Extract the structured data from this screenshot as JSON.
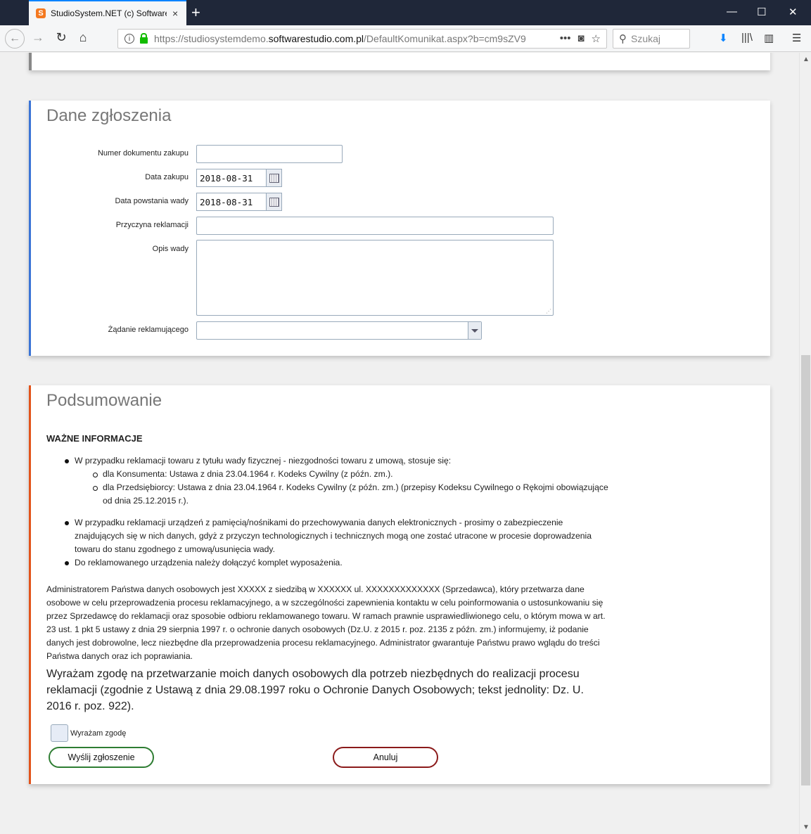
{
  "browser": {
    "tab_title": "StudioSystem.NET (c) Software",
    "tab_close": "×",
    "new_tab": "+",
    "window_controls": {
      "minimize": "—",
      "maximize": "☐",
      "close": "✕"
    },
    "url_prefix": "https://studiosystemdemo.",
    "url_domain": "softwarestudio.com.pl",
    "url_suffix": "/DefaultKomunikat.aspx?b=cm9sZV9",
    "url_more": "•••",
    "search_placeholder": "Szukaj"
  },
  "dane": {
    "title": "Dane zgłoszenia",
    "labels": {
      "numer": "Numer dokumentu zakupu",
      "data_zakupu": "Data zakupu",
      "data_wady": "Data powstania wady",
      "przyczyna": "Przyczyna reklamacji",
      "opis": "Opis wady",
      "zadanie": "Żądanie reklamującego"
    },
    "values": {
      "numer": "",
      "data_zakupu": "2018-08-31",
      "data_wady": "2018-08-31",
      "przyczyna": "",
      "opis": "",
      "zadanie": ""
    }
  },
  "podsumowanie": {
    "title": "Podsumowanie",
    "heading": "WAŻNE INFORMACJE",
    "bullet1": "W przypadku reklamacji towaru z tytułu wady fizycznej - niezgodności towaru z umową, stosuje się:",
    "sub1": "dla Konsumenta: Ustawa z dnia 23.04.1964 r. Kodeks Cywilny (z późn. zm.).",
    "sub2": "dla Przedsiębiorcy: Ustawa z dnia 23.04.1964 r. Kodeks Cywilny (z późn. zm.) (przepisy Kodeksu Cywilnego o Rękojmi obowiązujące od dnia 25.12.2015 r.).",
    "bullet2": "W przypadku reklamacji urządzeń z pamięcią/nośnikami do przechowywania danych elektronicznych - prosimy o zabezpieczenie znajdujących się w nich danych, gdyż z przyczyn technologicznych i technicznych mogą one zostać utracone w procesie doprowadzenia towaru do stanu zgodnego z umową/usunięcia wady.",
    "bullet3": "Do reklamowanego urządzenia należy dołączyć komplet wyposażenia.",
    "admin_text": "Administratorem Państwa danych osobowych jest XXXXX z siedzibą w XXXXXX ul. XXXXXXXXXXXXX (Sprzedawca), który przetwarza dane osobowe w celu przeprowadzenia procesu reklamacyjnego, a w szczególności zapewnienia kontaktu w celu poinformowania o ustosunkowaniu się przez Sprzedawcę do reklamacji oraz sposobie odbioru reklamowanego towaru. W ramach prawnie usprawiedliwionego celu, o którym mowa w art. 23 ust. 1 pkt 5 ustawy z dnia 29 sierpnia 1997 r. o ochronie danych osobowych (Dz.U. z 2015 r. poz. 2135 z późn. zm.) informujemy, iż podanie danych jest dobrowolne, lecz niezbędne dla przeprowadzenia procesu reklamacyjnego. Administrator gwarantuje Państwu prawo wglądu do treści Państwa danych oraz ich poprawiania.",
    "consent_text": "Wyrażam zgodę na przetwarzanie moich danych osobowych dla potrzeb niezbędnych do realizacji procesu reklamacji (zgodnie z Ustawą z dnia 29.08.1997 roku o Ochronie Danych Osobowych; tekst jednolity: Dz. U. 2016 r. poz. 922).",
    "checkbox_label": "Wyrażam zgodę",
    "checkbox_checked": false,
    "send_label": "Wyślij zgłoszenie",
    "cancel_label": "Anuluj"
  },
  "colors": {
    "dane_accent": "#3a74d6",
    "pods_accent": "#e2531a",
    "send_border": "#2e7d32",
    "cancel_border": "#8b1a1a"
  }
}
